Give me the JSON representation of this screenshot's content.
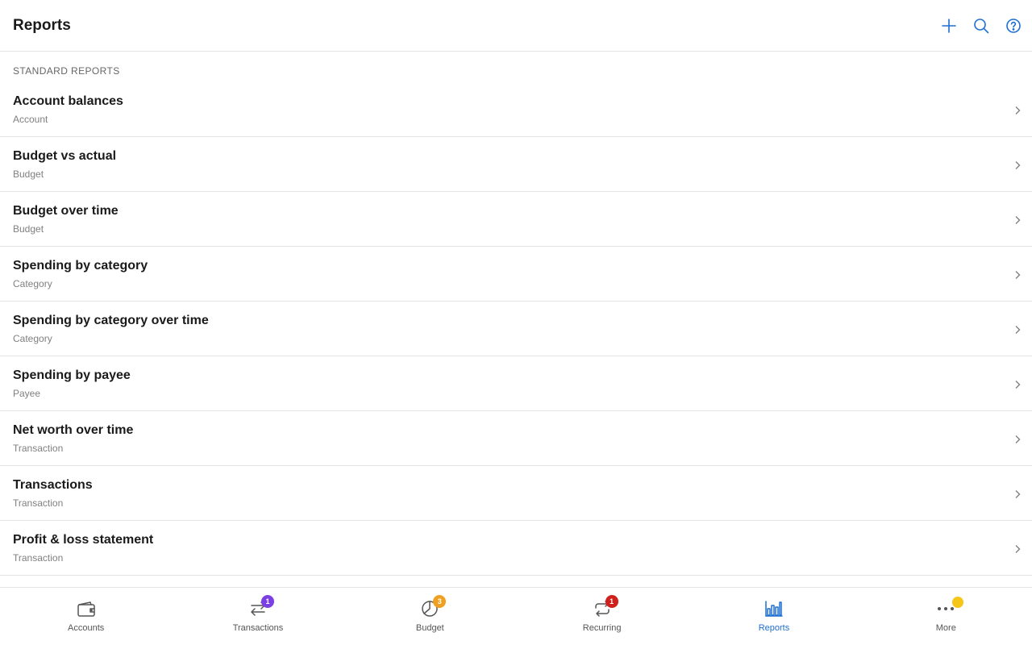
{
  "header": {
    "title": "Reports",
    "actions": [
      {
        "name": "add-button",
        "icon": "plus-icon"
      },
      {
        "name": "search-button",
        "icon": "search-icon"
      },
      {
        "name": "help-button",
        "icon": "help-icon"
      }
    ]
  },
  "section": {
    "label": "STANDARD REPORTS"
  },
  "reports": [
    {
      "title": "Account balances",
      "subtitle": "Account"
    },
    {
      "title": "Budget vs actual",
      "subtitle": "Budget"
    },
    {
      "title": "Budget over time",
      "subtitle": "Budget"
    },
    {
      "title": "Spending by category",
      "subtitle": "Category"
    },
    {
      "title": "Spending by category over time",
      "subtitle": "Category"
    },
    {
      "title": "Spending by payee",
      "subtitle": "Payee"
    },
    {
      "title": "Net worth over time",
      "subtitle": "Transaction"
    },
    {
      "title": "Transactions",
      "subtitle": "Transaction"
    },
    {
      "title": "Profit & loss statement",
      "subtitle": "Transaction"
    }
  ],
  "tabs": [
    {
      "label": "Accounts",
      "icon": "wallet-icon",
      "badge": null,
      "badge_color": null
    },
    {
      "label": "Transactions",
      "icon": "arrows-icon",
      "badge": "1",
      "badge_color": "#7b3fe4"
    },
    {
      "label": "Budget",
      "icon": "pie-icon",
      "badge": "3",
      "badge_color": "#f0a020"
    },
    {
      "label": "Recurring",
      "icon": "repeat-icon",
      "badge": "1",
      "badge_color": "#d0201b"
    },
    {
      "label": "Reports",
      "icon": "bar-chart-icon",
      "badge": null,
      "badge_color": null,
      "active": true
    },
    {
      "label": "More",
      "icon": "more-icon",
      "badge": null,
      "dot_color": "#f5c518"
    }
  ],
  "colors": {
    "accent": "#1f6fd1"
  }
}
